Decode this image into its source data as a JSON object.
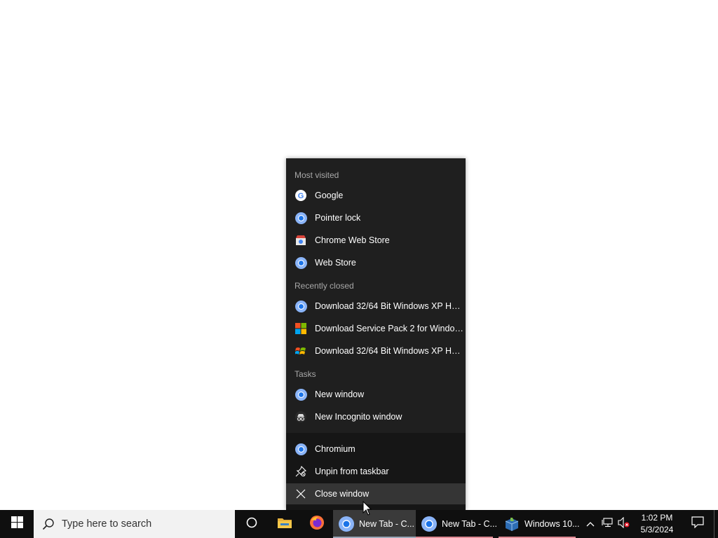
{
  "jumplist": {
    "sections": {
      "most_visited": "Most visited",
      "recently_closed": "Recently closed",
      "tasks": "Tasks"
    },
    "most_visited": [
      {
        "label": "Google",
        "icon": "google-icon"
      },
      {
        "label": "Pointer lock",
        "icon": "chromium-icon"
      },
      {
        "label": "Chrome Web Store",
        "icon": "web-store-icon"
      },
      {
        "label": "Web Store",
        "icon": "chromium-icon"
      }
    ],
    "recently_closed": [
      {
        "label": "Download 32/64 Bit Windows XP Hom...",
        "icon": "chromium-icon"
      },
      {
        "label": "Download Service Pack 2 for Windows...",
        "icon": "microsoft-icon"
      },
      {
        "label": "Download 32/64 Bit Windows XP Hom...",
        "icon": "windows-xp-icon"
      }
    ],
    "tasks": [
      {
        "label": "New window",
        "icon": "chromium-icon"
      },
      {
        "label": "New Incognito window",
        "icon": "incognito-icon"
      }
    ],
    "footer": [
      {
        "label": "Chromium",
        "icon": "chromium-icon"
      },
      {
        "label": "Unpin from taskbar",
        "icon": "unpin-icon"
      },
      {
        "label": "Close window",
        "icon": "close-icon"
      }
    ]
  },
  "taskbar": {
    "search_placeholder": "Type here to search",
    "apps": [
      {
        "label": "New Tab - C...",
        "icon": "chromium-icon",
        "active": true
      },
      {
        "label": "New Tab - C...",
        "icon": "chromium-icon",
        "active": false
      },
      {
        "label": "Windows 10...",
        "icon": "virtualbox-icon",
        "active": false
      }
    ],
    "clock": {
      "time": "1:02 PM",
      "date": "5/3/2024"
    }
  },
  "colors": {
    "menu_bg": "#1f1f1f",
    "menu_footer_bg": "#161616",
    "taskbar_bg": "#0f0f0f",
    "search_bg": "#f2f2f2",
    "chromium_blue": "#4a86e8",
    "tab_underline": "#e08a94"
  }
}
